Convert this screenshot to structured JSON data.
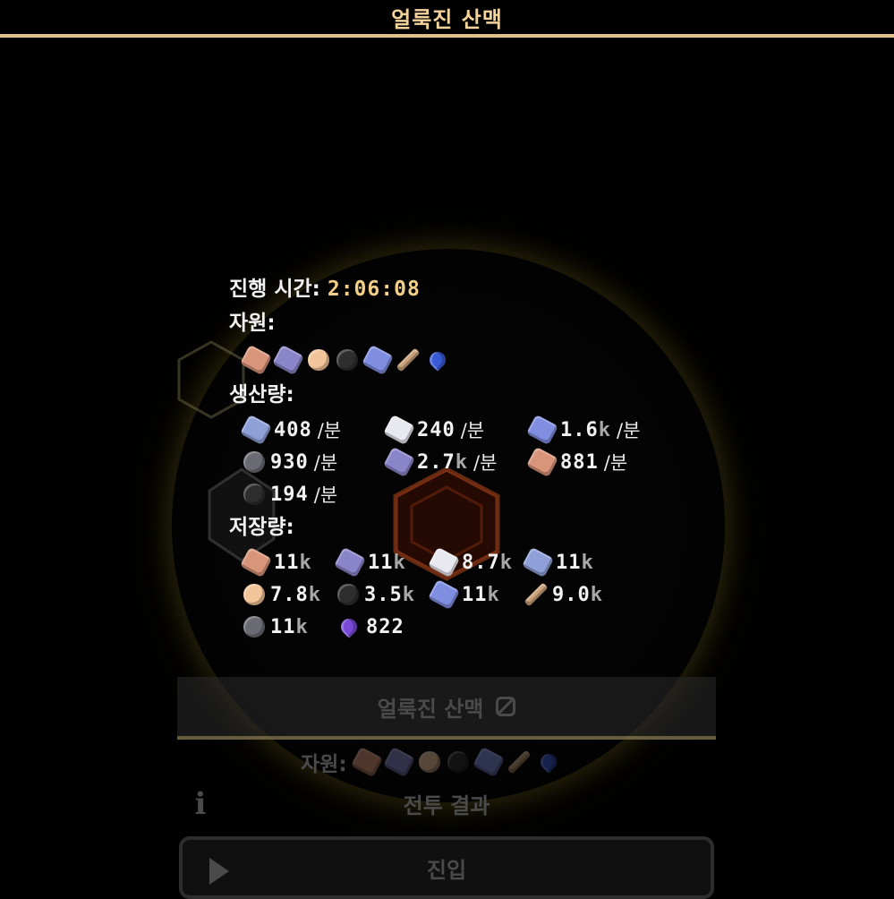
{
  "title": "얼룩진 산맥",
  "info": {
    "time_label": "진행 시간: ",
    "time_value": "2:06:08",
    "resources_label": "자원:",
    "resources": [
      {
        "icon": "copper-ore-icon",
        "color": "#d9957a"
      },
      {
        "icon": "lead-ore-icon",
        "color": "#8a84c8"
      },
      {
        "icon": "sand-icon",
        "color": "#f2c49a"
      },
      {
        "icon": "coal-icon",
        "color": "#2e2e2e"
      },
      {
        "icon": "titanium-ore-icon",
        "color": "#7f8ee0"
      },
      {
        "icon": "scrap-icon",
        "color": "#c9a27a"
      },
      {
        "icon": "water-drop-icon",
        "color": "#3a5bd8"
      }
    ],
    "production_label": "생산량:",
    "production": [
      {
        "icon": "metaglass-icon",
        "color": "#8fa0d8",
        "value": "408",
        "suffix": "",
        "unit": "/분"
      },
      {
        "icon": "silicon-icon",
        "color": "#e8e8f0",
        "value": "240",
        "suffix": "",
        "unit": "/분"
      },
      {
        "icon": "titanium-icon",
        "color": "#7f8ee0",
        "value": "1.6",
        "suffix": "k",
        "unit": "/분"
      },
      {
        "icon": "graphite-icon",
        "color": "#6a6a72",
        "value": "930",
        "suffix": "",
        "unit": "/분"
      },
      {
        "icon": "lead-icon",
        "color": "#8a84c8",
        "value": "2.7",
        "suffix": "k",
        "unit": "/분"
      },
      {
        "icon": "copper-icon",
        "color": "#d9957a",
        "value": "881",
        "suffix": "",
        "unit": "/분"
      },
      {
        "icon": "coal-icon",
        "color": "#2e2e2e",
        "value": "194",
        "suffix": "",
        "unit": "/분"
      }
    ],
    "storage_label": "저장량:",
    "storage": [
      {
        "icon": "copper-icon",
        "color": "#d9957a",
        "value": "11",
        "suffix": "k"
      },
      {
        "icon": "lead-icon",
        "color": "#8a84c8",
        "value": "11",
        "suffix": "k"
      },
      {
        "icon": "silicon-icon",
        "color": "#e8e8f0",
        "value": "8.7",
        "suffix": "k"
      },
      {
        "icon": "metaglass-icon",
        "color": "#8fa0d8",
        "value": "11",
        "suffix": "k"
      },
      {
        "icon": "sand-icon",
        "color": "#f2c49a",
        "value": "7.8",
        "suffix": "k"
      },
      {
        "icon": "coal-icon",
        "color": "#2e2e2e",
        "value": "3.5",
        "suffix": "k"
      },
      {
        "icon": "titanium-icon",
        "color": "#7f8ee0",
        "value": "11",
        "suffix": "k"
      },
      {
        "icon": "scrap-icon",
        "color": "#c9a27a",
        "value": "9.0",
        "suffix": "k"
      },
      {
        "icon": "graphite-icon",
        "color": "#6a6a72",
        "value": "11",
        "suffix": "k"
      },
      {
        "icon": "spore-pod-icon",
        "color": "#7a4ad8",
        "value": "822",
        "suffix": ""
      }
    ]
  },
  "panel": {
    "sector_name": "얼룩진 산맥",
    "resources_label": "자원:",
    "battle_result_label": "전투 결과",
    "enter_label": "진입"
  }
}
